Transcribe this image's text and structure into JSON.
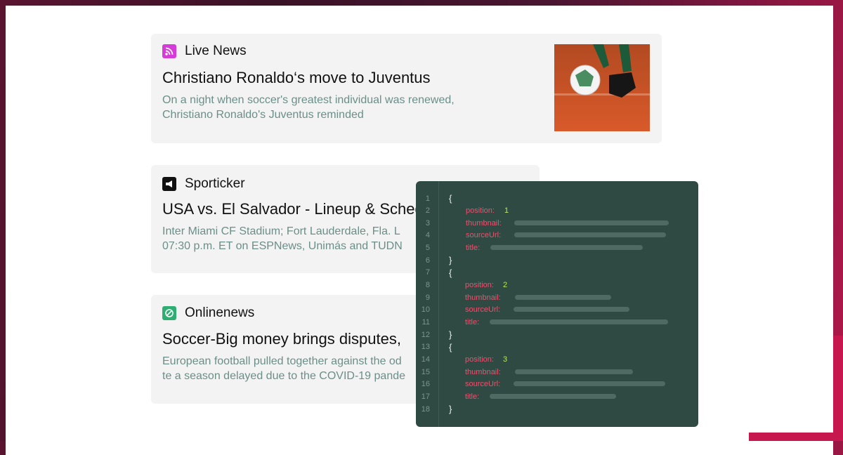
{
  "cards": [
    {
      "source": "Live News",
      "icon": "rss-icon",
      "icon_color": "#d63ad8",
      "headline": "Christiano Ronaldo‘s move to Juventus",
      "snippet_lines": [
        "On a night when soccer's greatest individual was renewed,",
        "Christiano Ronaldo's Juventus reminded"
      ]
    },
    {
      "source": "Sporticker",
      "icon": "megaphone-icon",
      "icon_color": "#111111",
      "headline": "USA vs. El Salvador - Lineup & Schedule",
      "snippet_lines": [
        "Inter Miami CF Stadium; Fort Lauderdale, Fla. L",
        "07:30 p.m. ET on ESPNews, Unimás and TUDN"
      ]
    },
    {
      "source": "Onlinenews",
      "icon": "soccer-ball-icon",
      "icon_color": "#2fae73",
      "headline": "Soccer-Big money brings disputes,",
      "snippet_lines": [
        "European football pulled together against the od",
        "te a season delayed due to the COVID-19 pande"
      ]
    }
  ],
  "code": {
    "line_numbers": [
      "1",
      "2",
      "3",
      "4",
      "5",
      "6",
      "7",
      "8",
      "9",
      "10",
      "11",
      "12",
      "13",
      "14",
      "15",
      "16",
      "17",
      "18"
    ],
    "open_brace": "{",
    "close_brace": "}",
    "keys": {
      "position": "position:",
      "thumbnail": "thumbnail:",
      "sourceUrl": "sourceUrl:",
      "title": "title:"
    },
    "positions": [
      "1",
      "2",
      "3"
    ]
  },
  "colors": {
    "accent": "#c7174f",
    "code_bg": "#2f4a42",
    "key": "#ef4f6e",
    "number": "#b9e85a",
    "snippet": "#6b8f88"
  }
}
